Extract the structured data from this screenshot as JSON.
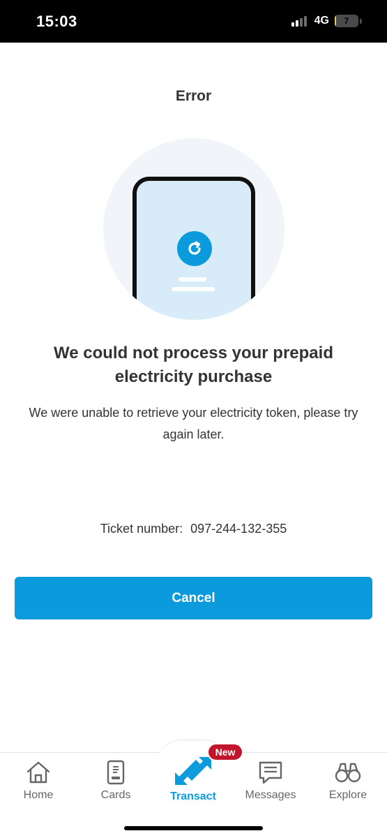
{
  "status_bar": {
    "time": "15:03",
    "network": "4G",
    "battery_level": "7",
    "battery_percent": 7
  },
  "header": {
    "title": "Error"
  },
  "illustration": {
    "icon": "refresh-icon"
  },
  "message": {
    "headline": "We could not process your prepaid electricity purchase",
    "description": "We were unable to retrieve your electricity token, please try again later."
  },
  "ticket": {
    "label": "Ticket number:",
    "value": "097-244-132-355"
  },
  "actions": {
    "cancel_label": "Cancel"
  },
  "bottom_nav": {
    "items": [
      {
        "label": "Home",
        "icon": "home-icon"
      },
      {
        "label": "Cards",
        "icon": "card-icon"
      },
      {
        "label": "Transact",
        "icon": "transfer-arrows-icon",
        "active": true
      },
      {
        "label": "Messages",
        "icon": "message-icon"
      },
      {
        "label": "Explore",
        "icon": "binoculars-icon"
      }
    ],
    "badge": "New"
  },
  "colors": {
    "accent": "#0b9bdc",
    "badge": "#c0152b",
    "text": "#333333"
  }
}
